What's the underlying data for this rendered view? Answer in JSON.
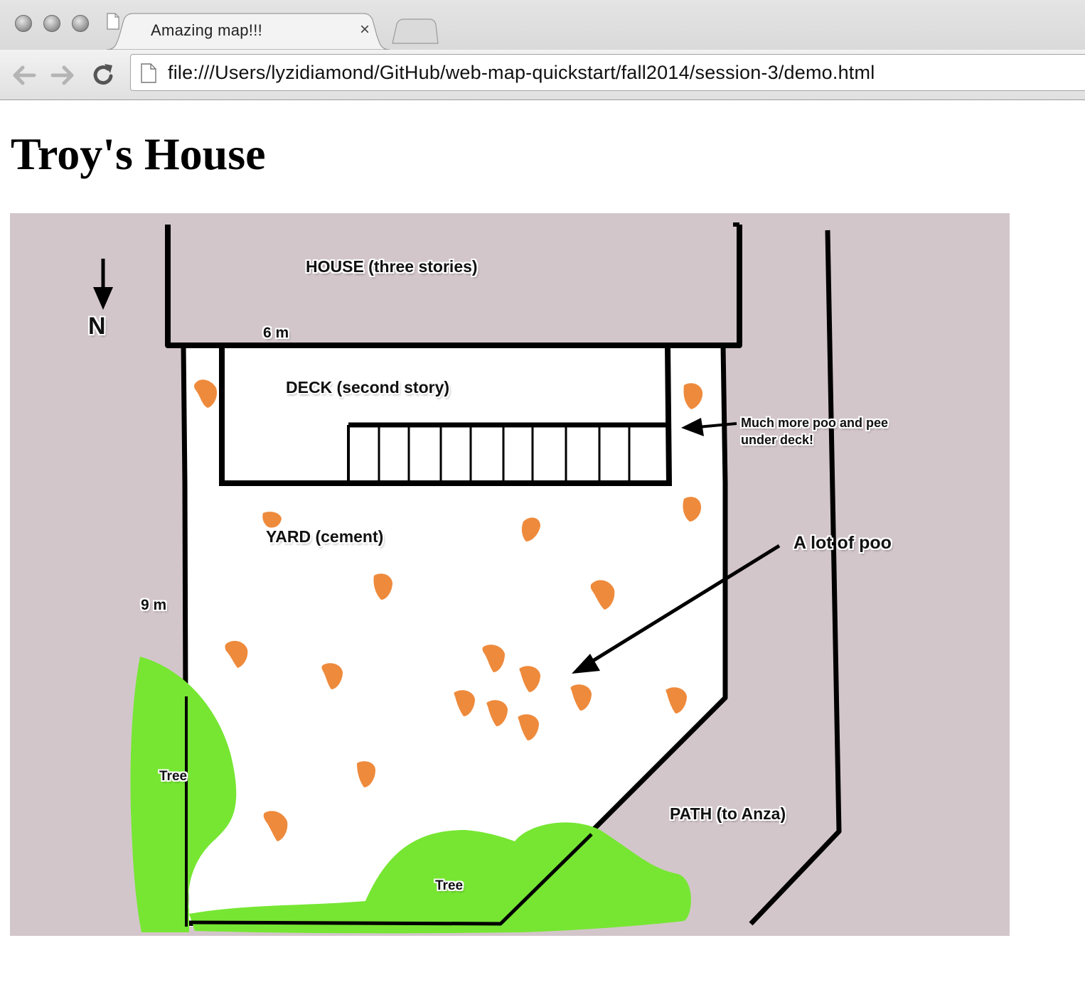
{
  "browser": {
    "tab_title": "Amazing map!!!",
    "tab_close": "×",
    "url": "file:///Users/lyzidiamond/GitHub/web-map-quickstart/fall2014/session-3/demo.html"
  },
  "page": {
    "title": "Troy's House"
  },
  "map": {
    "north_label": "N",
    "house_label": "HOUSE (three stories)",
    "width_label": "6 m",
    "deck_label": "DECK (second story)",
    "deck_note": "Much more poo and pee under deck!",
    "yard_label": "YARD (cement)",
    "poo_note": "A lot of poo",
    "height_label": "9 m",
    "tree_left_label": "Tree",
    "tree_bottom_label": "Tree",
    "path_label": "PATH (to Anza)",
    "colors": {
      "background": "#d3c6ca",
      "yard": "#ffffff",
      "tree": "#76e632",
      "poo": "#ee8a3c"
    }
  }
}
